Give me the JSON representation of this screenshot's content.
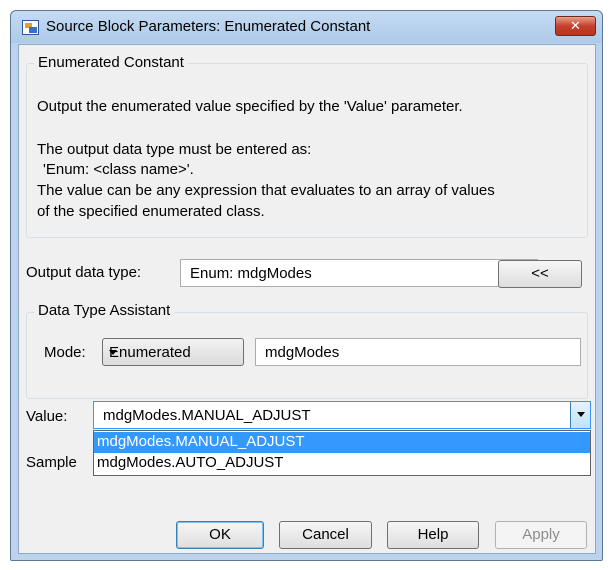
{
  "window": {
    "title": "Source Block Parameters: Enumerated Constant",
    "close_label": "✕"
  },
  "block": {
    "group_title": "Enumerated Constant",
    "description": [
      "Output the enumerated value specified by the 'Value' parameter.",
      "The output data type must be entered as:",
      "'Enum: <class name>'.",
      "The value can be any expression that evaluates to an array of values",
      "of the specified enumerated class."
    ]
  },
  "output_data_type": {
    "label": "Output data type:",
    "value": "Enum: mdgModes",
    "assistant_button": "<<"
  },
  "data_type_assistant": {
    "group_title": "Data Type Assistant",
    "mode_label": "Mode:",
    "mode_value": "Enumerated",
    "class_name": "mdgModes"
  },
  "value_param": {
    "label": "Value:",
    "value": "mdgModes.MANUAL_ADJUST",
    "options": [
      "mdgModes.MANUAL_ADJUST",
      "mdgModes.AUTO_ADJUST"
    ],
    "selected_index": 0
  },
  "sample_time": {
    "label_visible": "Sample"
  },
  "buttons": {
    "ok": "OK",
    "cancel": "Cancel",
    "help": "Help",
    "apply": "Apply"
  },
  "colors": {
    "selection": "#3399ff",
    "dialog_bg": "#f0f0f0",
    "frame": "#bcd3ec",
    "close": "#c6402b"
  }
}
